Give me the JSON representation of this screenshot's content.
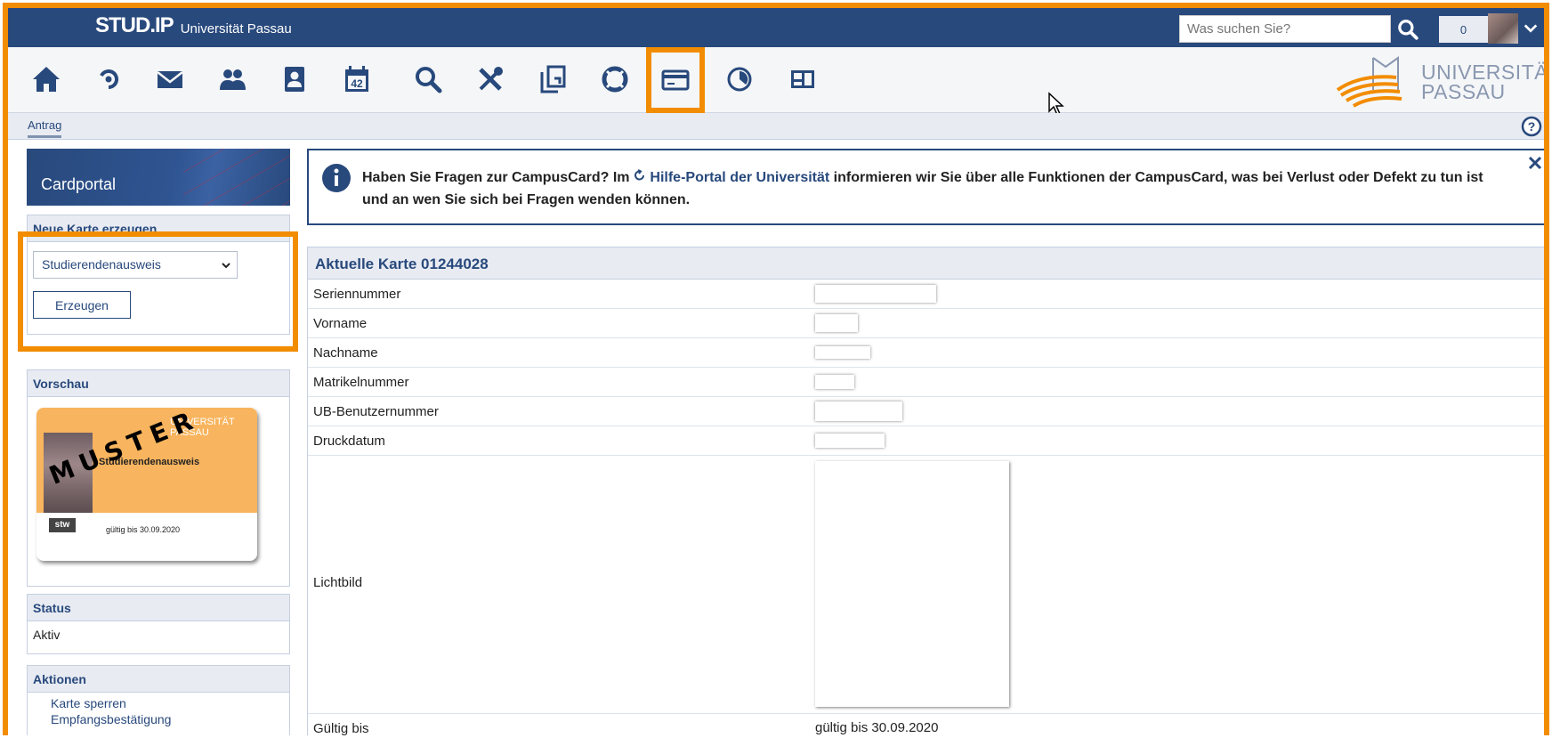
{
  "header": {
    "logo": "STUD.IP",
    "university": "Universität Passau",
    "search_placeholder": "Was suchen Sie?",
    "notification_count": "0"
  },
  "nav": {
    "icons": [
      "home-icon",
      "activity-icon",
      "mail-icon",
      "community-icon",
      "profile-icon",
      "calendar-icon",
      "search-icon",
      "tools-icon",
      "files-icon",
      "help-ring-icon",
      "campuscard-icon",
      "stats-icon",
      "layout-icon"
    ],
    "calendar_day": "42",
    "uni_logo_line1": "UNIVERSITÄT",
    "uni_logo_line2": "PASSAU"
  },
  "subnav": {
    "tab": "Antrag"
  },
  "sidebar": {
    "title": "Cardportal",
    "new_card": {
      "heading": "Neue Karte erzeugen",
      "select_value": "Studierendenausweis",
      "button": "Erzeugen"
    },
    "preview": {
      "heading": "Vorschau",
      "card_title": "Studierendenausweis",
      "card_valid": "gültig bis 30.09.2020",
      "watermark": "MUSTER",
      "card_uni": "UNIVERSITÄT PASSAU"
    },
    "status": {
      "heading": "Status",
      "value": "Aktiv"
    },
    "actions": {
      "heading": "Aktionen",
      "items": [
        "Karte sperren",
        "Empfangsbestätigung"
      ]
    }
  },
  "info": {
    "text_before": "Haben Sie Fragen zur CampusCard? Im ",
    "link": "Hilfe-Portal der Universität",
    "text_after": " informieren wir Sie über alle Funktionen der CampusCard, was bei Verlust oder Defekt zu tun ist und an wen Sie sich bei Fragen wenden können."
  },
  "card_table": {
    "heading": "Aktuelle Karte 01244028",
    "rows": [
      {
        "label": "Seriennummer"
      },
      {
        "label": "Vorname"
      },
      {
        "label": "Nachname"
      },
      {
        "label": "Matrikelnummer"
      },
      {
        "label": "UB-Benutzernummer"
      },
      {
        "label": "Druckdatum"
      },
      {
        "label": "Lichtbild"
      },
      {
        "label": "Gültig bis",
        "value": "gültig bis 30.09.2020"
      }
    ]
  },
  "colors": {
    "primary": "#28497c",
    "highlight": "#f28c00",
    "panel": "#e8ebf2"
  }
}
